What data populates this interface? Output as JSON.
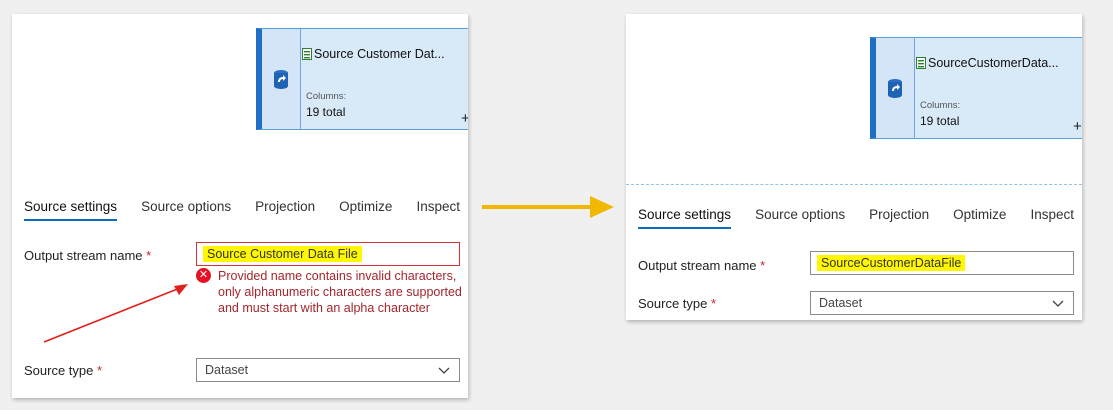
{
  "left": {
    "node": {
      "title": "Source Customer Dat...",
      "columns_label": "Columns:",
      "columns_value": "19 total",
      "plus": "+"
    },
    "tabs": [
      "Source settings",
      "Source options",
      "Projection",
      "Optimize",
      "Inspect"
    ],
    "output_stream": {
      "label": "Output stream name",
      "required": "*",
      "value": "Source Customer Data File"
    },
    "error": {
      "icon": "✕",
      "message": "Provided name contains invalid characters, only alphanumeric characters are supported and must start with an alpha character"
    },
    "source_type": {
      "label": "Source type",
      "required": "*",
      "value": "Dataset"
    }
  },
  "right": {
    "node": {
      "title": "SourceCustomerData...",
      "columns_label": "Columns:",
      "columns_value": "19 total",
      "plus": "+"
    },
    "tabs": [
      "Source settings",
      "Source options",
      "Projection",
      "Optimize",
      "Inspect"
    ],
    "output_stream": {
      "label": "Output stream name",
      "required": "*",
      "value": "SourceCustomerDataFile"
    },
    "source_type": {
      "label": "Source type",
      "required": "*",
      "value": "Dataset"
    }
  },
  "colors": {
    "accent": "#0f6cbd",
    "error": "#a4262c",
    "highlight": "#fff700",
    "node_fill": "#d8e9f8",
    "arrow_red": "#e0201c",
    "arrow_yellow": "#f2b800"
  },
  "icons": {
    "source": "dataset-source-icon",
    "small": "spreadsheet-icon",
    "chevron": "chevron-down-icon"
  }
}
